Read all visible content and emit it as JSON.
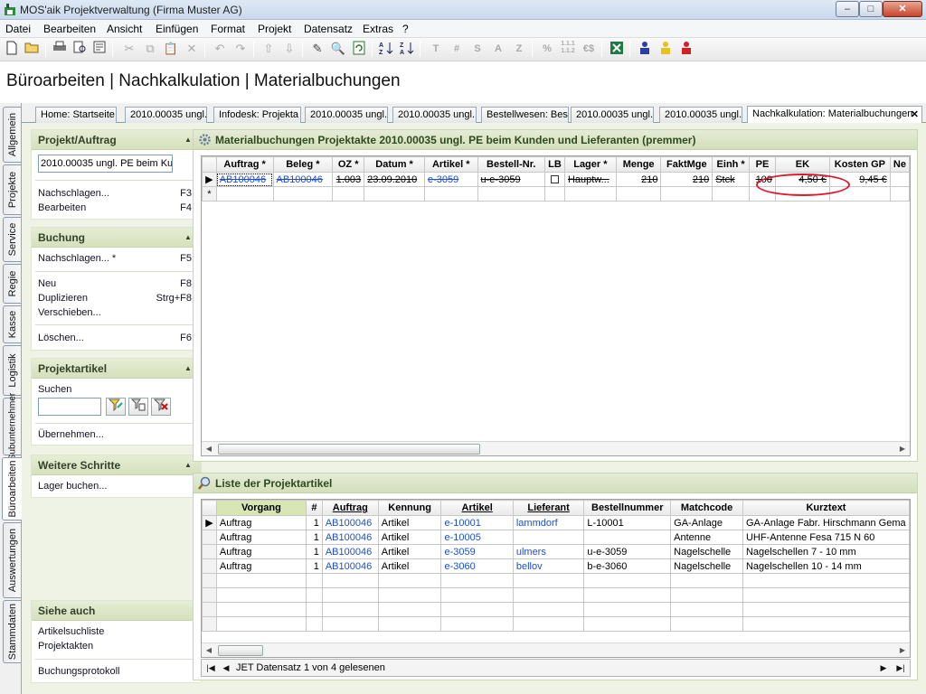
{
  "window": {
    "title": "MOS'aik Projektverwaltung (Firma Muster AG)",
    "min": "–",
    "max": "□",
    "close": "✕"
  },
  "menu": [
    "Datei",
    "Bearbeiten",
    "Ansicht",
    "Einfügen",
    "Format",
    "Projekt",
    "Datensatz",
    "Extras",
    "?"
  ],
  "toolbar": {
    "text_buttons": [
      "T",
      "#",
      "S",
      "A",
      "Z"
    ],
    "pct": "%",
    "euro": "€$",
    "num_fmt": "1.1.1\n1.1.2"
  },
  "heading": "Büroarbeiten | Nachkalkulation | Materialbuchungen",
  "vertical_tabs": [
    "Allgemein",
    "Projekte",
    "Service",
    "Regie",
    "Kasse",
    "Logistik",
    "Subunternehmer",
    "Büroarbeiten",
    "Auswertungen",
    "Stammdaten"
  ],
  "doc_tabs": [
    "Home: Startseite",
    "2010.00035 ungl.",
    "Infodesk: Projekta",
    "2010.00035 ungl.",
    "2010.00035 ungl.",
    "Bestellwesen: Best",
    "2010.00035 ungl.",
    "2010.00035 ungl.",
    "Nachkalkulation: Materialbuchungen"
  ],
  "doc_tab_close": "✕",
  "panels": {
    "projekt": {
      "title": "Projekt/Auftrag",
      "input_value": "2010.00035 ungl. PE beim Kur",
      "items": [
        {
          "label": "Nachschlagen...",
          "key": "F3"
        },
        {
          "label": "Bearbeiten",
          "key": "F4"
        }
      ]
    },
    "buchung": {
      "title": "Buchung",
      "items": [
        {
          "label": "Nachschlagen... *",
          "key": "F5"
        },
        {
          "label": "Neu",
          "key": "F8"
        },
        {
          "label": "Duplizieren",
          "key": "Strg+F8"
        },
        {
          "label": "Verschieben...",
          "key": ""
        },
        {
          "label": "Löschen...",
          "key": "F6"
        }
      ]
    },
    "projektartikel": {
      "title": "Projektartikel",
      "search_label": "Suchen",
      "search_value": "",
      "take_over": "Übernehmen..."
    },
    "weitere": {
      "title": "Weitere Schritte",
      "items": [
        {
          "label": "Lager buchen...",
          "key": ""
        }
      ]
    },
    "siehe": {
      "title": "Siehe auch",
      "items": [
        {
          "label": "Artikelsuchliste"
        },
        {
          "label": "Projektakten"
        },
        {
          "label": "Buchungsprotokoll"
        }
      ]
    }
  },
  "materialbuchungen": {
    "title": "Materialbuchungen Projektakte 2010.00035 ungl. PE beim Kunden und Lieferanten (premmer)",
    "columns": [
      "Auftrag *",
      "Beleg *",
      "OZ *",
      "Datum *",
      "Artikel *",
      "Bestell-Nr.",
      "LB",
      "Lager *",
      "Menge",
      "FaktMge",
      "Einh *",
      "PE",
      "EK",
      "Kosten GP",
      "Ne"
    ],
    "rows": [
      {
        "auftrag": "AB100046",
        "beleg": "AB100046",
        "oz": "1.003",
        "datum": "23.09.2010",
        "artikel": "e-3059",
        "bestell": "u-e-3059",
        "lb": "",
        "lager": "Hauptw...",
        "menge": "210",
        "fakt": "210",
        "einh": "Stck",
        "pe": "100",
        "ek": "4,50 €",
        "kosten": "9,45 €"
      }
    ],
    "new_row_marker": "*",
    "row_marker": "▶"
  },
  "liste": {
    "title": "Liste der Projektartikel",
    "columns": [
      "Vorgang",
      "#",
      "Auftrag",
      "Kennung",
      "Artikel",
      "Lieferant",
      "Bestellnummer",
      "Matchcode",
      "Kurztext"
    ],
    "rows": [
      {
        "vorgang": "Auftrag",
        "nr": "1",
        "auftrag": "AB100046",
        "kennung": "Artikel",
        "artikel": "e-10001",
        "lieferant": "lammdorf",
        "bestell": "L-10001",
        "match": "GA-Anlage",
        "kurz": "GA-Anlage Fabr. Hirschmann Gema"
      },
      {
        "vorgang": "Auftrag",
        "nr": "1",
        "auftrag": "AB100046",
        "kennung": "Artikel",
        "artikel": "e-10005",
        "lieferant": "",
        "bestell": "",
        "match": "Antenne",
        "kurz": "UHF-Antenne Fesa 715 N 60"
      },
      {
        "vorgang": "Auftrag",
        "nr": "1",
        "auftrag": "AB100046",
        "kennung": "Artikel",
        "artikel": "e-3059",
        "lieferant": "ulmers",
        "bestell": "u-e-3059",
        "match": "Nagelschelle",
        "kurz": "Nagelschellen 7 - 10 mm"
      },
      {
        "vorgang": "Auftrag",
        "nr": "1",
        "auftrag": "AB100046",
        "kennung": "Artikel",
        "artikel": "e-3060",
        "lieferant": "bellov",
        "bestell": "b-e-3060",
        "match": "Nagelschelle",
        "kurz": "Nagelschellen 10 - 14 mm"
      }
    ],
    "status": "JET Datensatz 1 von 4 gelesenen",
    "row_marker": "▶"
  },
  "colors": {
    "accent_green": "#d5e0bc",
    "link_blue": "#1f4fc9",
    "highlight_red": "#e0182c"
  }
}
